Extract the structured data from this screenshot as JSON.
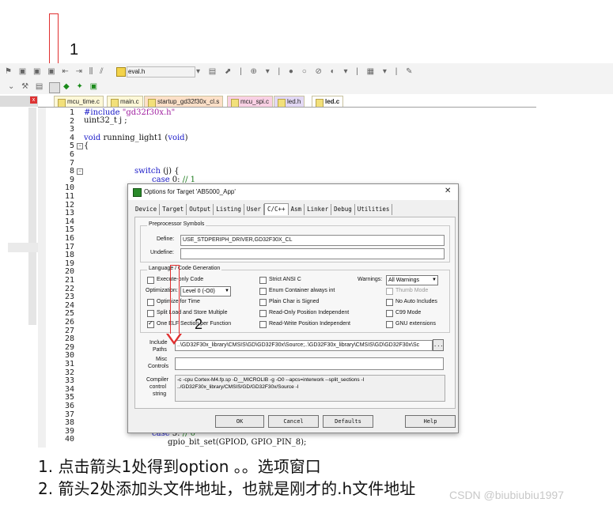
{
  "annotations": {
    "marker1": "1",
    "marker2": "2"
  },
  "toolbar": {
    "target_name": "eval.h"
  },
  "tabs": [
    "mcu_time.c",
    "main.c",
    "startup_gd32f30x_cl.s",
    "mcu_spi.c",
    "led.h",
    "led.c"
  ],
  "editor": {
    "line_numbers": [
      "1",
      "2",
      "3",
      "4",
      "5",
      "6",
      "7",
      "8",
      "9",
      "10",
      "11",
      "12",
      "13",
      "14",
      "15",
      "16",
      "17",
      "18",
      "19",
      "20",
      "21",
      "22",
      "23",
      "24",
      "25",
      "26",
      "27",
      "28",
      "29",
      "30",
      "31",
      "32",
      "33",
      "34",
      "35",
      "36",
      "37",
      "38",
      "39",
      "40"
    ],
    "line1_kw": "#include",
    "line1_str": "\"gd32f30x.h\"",
    "line2": "uint32_t j ;",
    "line4_kw": "void",
    "line4_rest": " running_light1 (",
    "line4_kw2": "void",
    "line4_end": ")",
    "line5": "{",
    "line8_kw": "switch",
    "line8_rest": " (j) {",
    "line9_kw": "case",
    "line9_rest": " 0: ",
    "line9_cm": "// 1",
    "line39_kw": "case",
    "line39_rest": " 5: ",
    "line39_cm": "// 0",
    "line40": "gpio_bit_set(GPIOD, GPIO_PIN_8);"
  },
  "dialog": {
    "title": "Options for Target 'AB5000_App'",
    "close": "✕",
    "tabs": [
      "Device",
      "Target",
      "Output",
      "Listing",
      "User",
      "C/C++",
      "Asm",
      "Linker",
      "Debug",
      "Utilities"
    ],
    "active_tab": "C/C++",
    "preproc": {
      "title": "Preprocessor Symbols",
      "define_label": "Define:",
      "define_value": "USE_STDPERIPH_DRIVER,GD32F30X_CL",
      "undefine_label": "Undefine:",
      "undefine_value": ""
    },
    "lang": {
      "title": "Language / Code Generation",
      "execute_only": "Execute-only Code",
      "optimization_label": "Optimization:",
      "optimization_value": "Level 0 (-O0)",
      "optimize_time": "Optimize for Time",
      "split_load": "Split Load and Store Multiple",
      "one_elf": "One ELF Section per Function",
      "strict_ansi": "Strict ANSI C",
      "enum_container": "Enum Container always int",
      "plain_char": "Plain Char is Signed",
      "ro_pi": "Read-Only Position Independent",
      "rw_pi": "Read-Write Position Independent",
      "warnings_label": "Warnings:",
      "warnings_value": "All Warnings",
      "thumb_mode": "Thumb Mode",
      "no_auto_includes": "No Auto Includes",
      "c99_mode": "C99 Mode",
      "gnu_ext": "GNU extensions"
    },
    "include_label_1": "Include",
    "include_label_2": "Paths",
    "include_value": "..\\GD32F30x_library\\CMSIS\\GD\\GD32F30x\\Source;..\\GD32F30x_library\\CMSIS\\GD\\GD32F30x\\Sc",
    "browse": "...",
    "misc_label_1": "Misc",
    "misc_label_2": "Controls",
    "misc_value": "",
    "compiler_label_1": "Compiler",
    "compiler_label_2": "control",
    "compiler_label_3": "string",
    "compiler_line1": "-c -cpu Cortex-M4.fp.sp -D__MICROLIB -g -O0 --apcs=interwork --split_sections -I",
    "compiler_line2": "../GD32F30x_library/CMSIS/GD/GD32F30x/Source -I",
    "buttons": {
      "ok": "OK",
      "cancel": "Cancel",
      "defaults": "Defaults",
      "help": "Help"
    }
  },
  "instructions": {
    "line1": "1.   点击箭头1处得到option 。。选项窗口",
    "line2": "2.   箭头2处添加头文件地址，也就是刚才的.h文件地址"
  },
  "watermark": "CSDN @biubiubiu1997"
}
